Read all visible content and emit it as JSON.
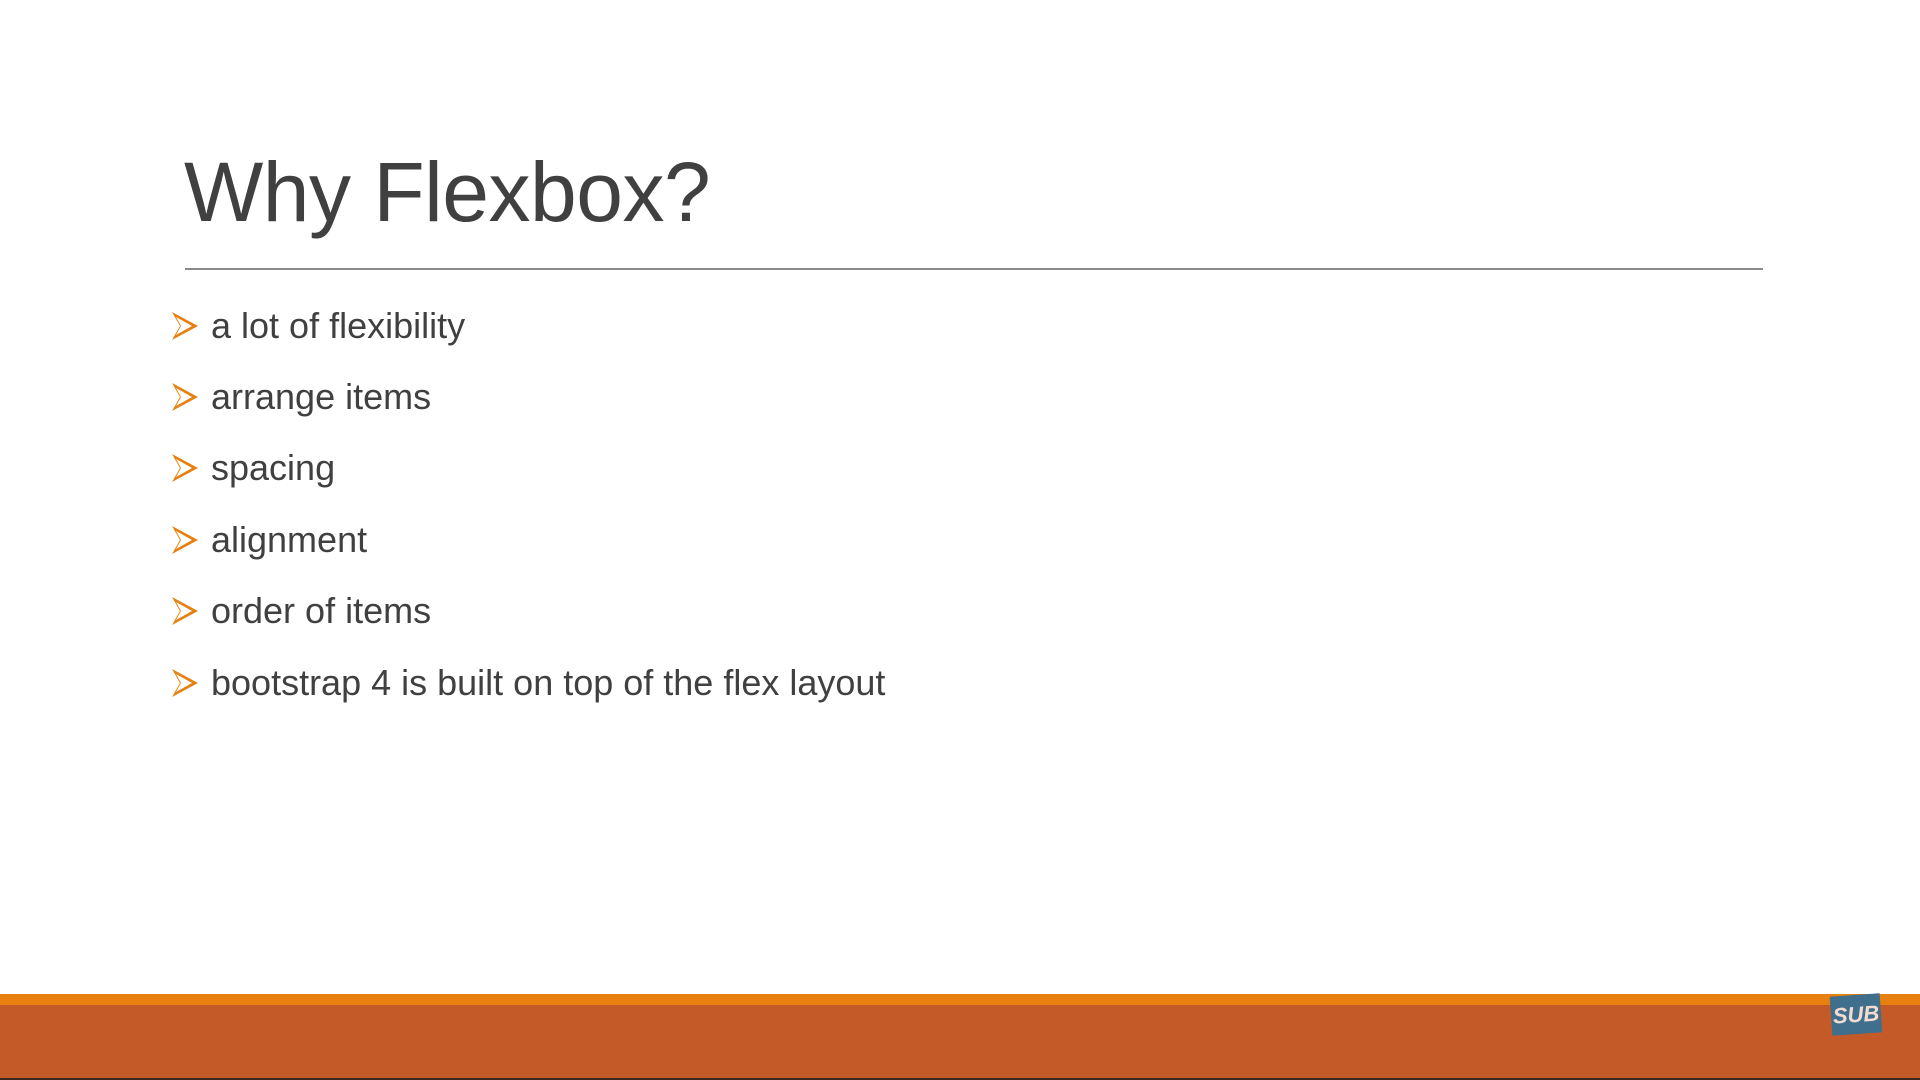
{
  "slide": {
    "title": "Why Flexbox?",
    "bullets": [
      "a lot of flexibility",
      "arrange items",
      "spacing",
      "alignment",
      "order of items",
      "bootstrap 4 is built on top of the flex layout"
    ],
    "badge": "SUB"
  },
  "colors": {
    "accent": "#e8800f",
    "footer": "#c45a28",
    "text": "#404040",
    "badge": "#3f6f8c"
  }
}
